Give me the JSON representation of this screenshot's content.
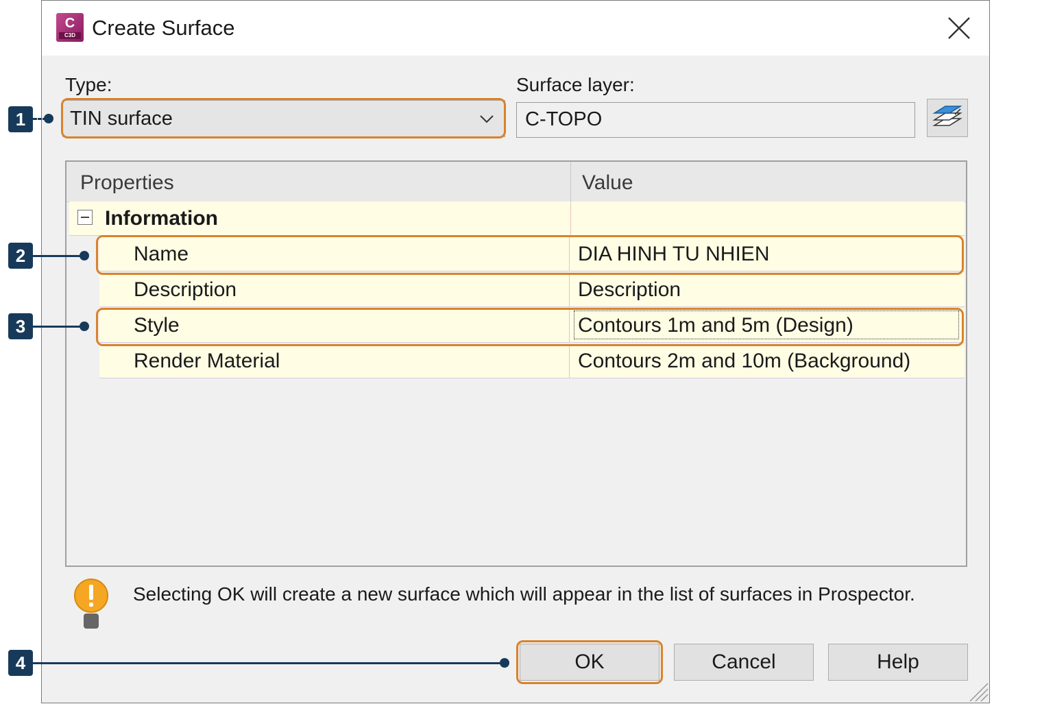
{
  "window": {
    "app_icon_text": "C",
    "app_icon_sub": "C3D",
    "title": "Create Surface"
  },
  "type_field": {
    "label": "Type:",
    "value": "TIN surface"
  },
  "layer_field": {
    "label": "Surface layer:",
    "value": "C-TOPO"
  },
  "grid": {
    "columns": [
      "Properties",
      "Value"
    ],
    "group": "Information",
    "rows": [
      {
        "property": "Name",
        "value": "DIA HINH TU NHIEN"
      },
      {
        "property": "Description",
        "value": "Description"
      },
      {
        "property": "Style",
        "value": "Contours 1m and 5m (Design)"
      },
      {
        "property": "Render Material",
        "value": "Contours 2m and 10m (Background)"
      }
    ]
  },
  "info_message": "Selecting OK will create a new surface which will appear in the list of surfaces in Prospector.",
  "buttons": {
    "ok": "OK",
    "cancel": "Cancel",
    "help": "Help"
  },
  "callouts": [
    "1",
    "2",
    "3",
    "4"
  ],
  "colors": {
    "highlight": "#d9822b",
    "callout": "#183a5a",
    "row_background": "#fffde4",
    "app_icon": "#a0306f"
  }
}
